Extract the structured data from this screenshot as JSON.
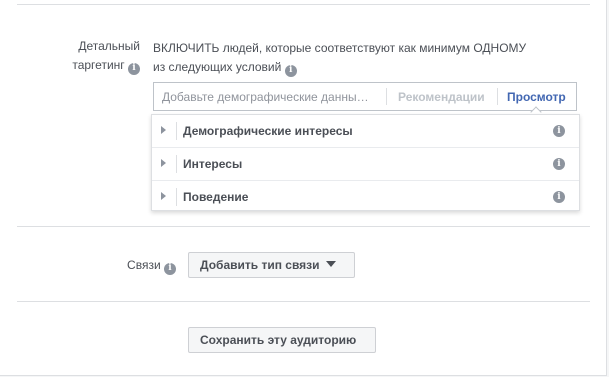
{
  "detailed_targeting": {
    "label_line1": "Детальный",
    "label_line2": "таргетинг",
    "description_line1": "ВКЛЮЧИТЬ людей, которые соответствуют как минимум ОДНОМУ",
    "description_line2": "из следующих условий",
    "search_placeholder": "Добавьте демографические данны…",
    "suggestions_label": "Рекомендации",
    "browse_label": "Просмотр",
    "categories": [
      {
        "label": "Демографические интересы"
      },
      {
        "label": "Интересы"
      },
      {
        "label": "Поведение"
      }
    ]
  },
  "connections": {
    "label": "Связи",
    "add_button_label": "Добавить тип связи"
  },
  "save_audience_label": "Сохранить эту аудиторию",
  "icons": {
    "info": "info-circle-icon",
    "expand": "caret-right-icon",
    "dropdown": "caret-down-icon"
  },
  "colors": {
    "accent": "#4267b2",
    "text": "#4b4f56",
    "muted": "#90949c"
  }
}
